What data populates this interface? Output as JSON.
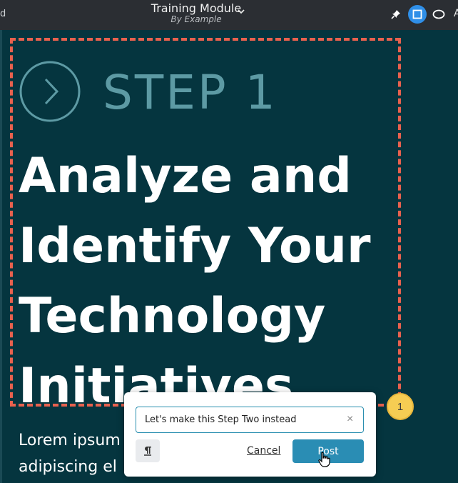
{
  "app": {
    "left_cut_text": "d",
    "title": "Training Module",
    "subtitle": "By Example",
    "right_cut_text": "A"
  },
  "toolbar": {
    "tools": [
      {
        "name": "pin",
        "icon": "pin-icon",
        "active": false
      },
      {
        "name": "rectangle",
        "icon": "rectangle-select-icon",
        "active": true
      },
      {
        "name": "ellipse",
        "icon": "ellipse-icon",
        "active": false
      }
    ]
  },
  "slide": {
    "step_label": "STEP 1",
    "headline_lines": [
      "Analyze and",
      "Identify Your",
      "Technology",
      "Initiatives"
    ],
    "body_lines": [
      "Lorem ipsum",
      "adipiscing el"
    ],
    "frame_color": "#e8614e",
    "background_color": "#05353f"
  },
  "annotation": {
    "badge_number": "1",
    "badge_color": "#f6cd53"
  },
  "comment": {
    "input_value": "Let's make this Step Two instead",
    "clear_label": "×",
    "cancel_label": "Cancel",
    "post_label": "Post",
    "post_color": "#2a8db4"
  }
}
